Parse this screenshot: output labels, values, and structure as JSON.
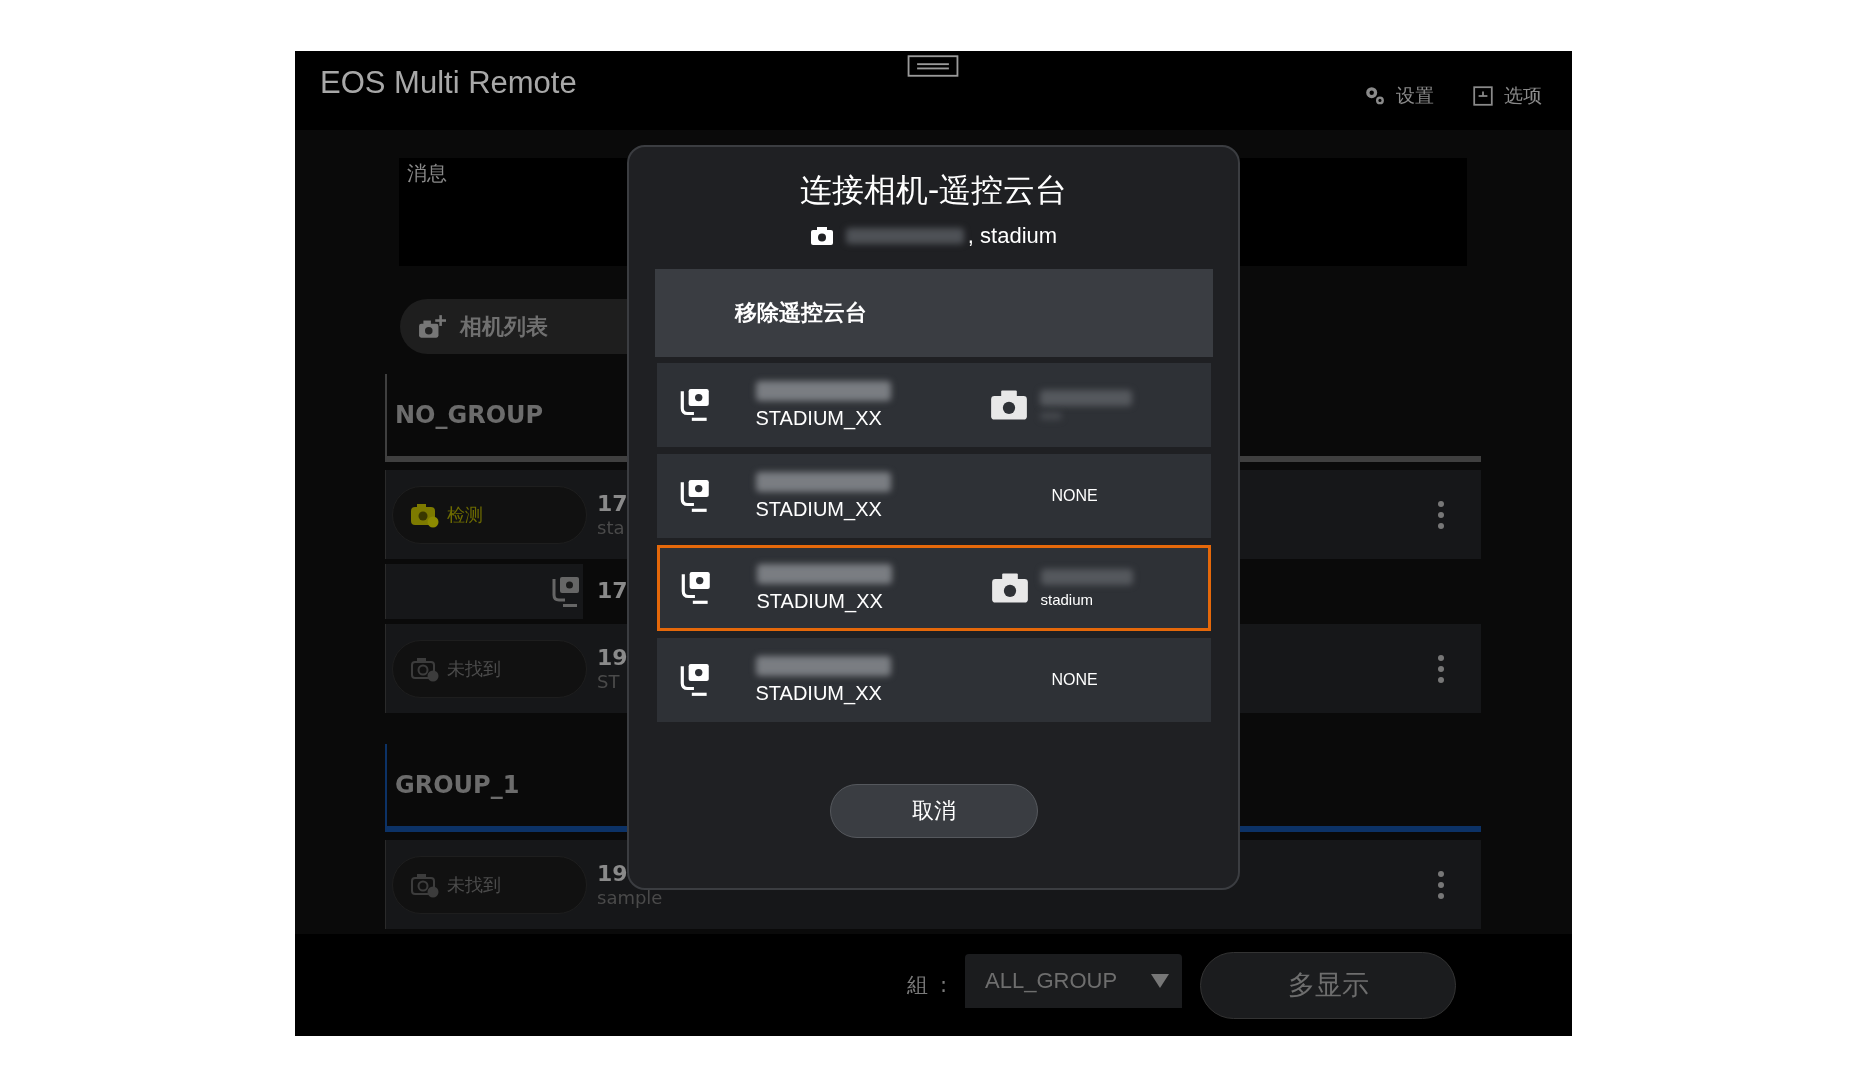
{
  "app": {
    "title": "EOS Multi Remote",
    "menu": [
      {
        "label": "设置",
        "kind": "settings"
      },
      {
        "label": "选项",
        "kind": "options"
      }
    ]
  },
  "message_panel": {
    "label": "消息"
  },
  "camera_list_button": {
    "label": "相机列表"
  },
  "groups": [
    {
      "name": "NO_GROUP",
      "color": "#3f3f3f",
      "rows": [
        {
          "kind": "camera",
          "status": {
            "kind": "detecting",
            "label": "检测"
          },
          "line_1": "17",
          "line_2": "sta"
        },
        {
          "kind": "ptz",
          "line_1": "17"
        },
        {
          "kind": "camera",
          "status": {
            "kind": "not_found",
            "label": "未找到"
          },
          "line_1": "19",
          "line_2": "ST"
        }
      ]
    },
    {
      "name": "GROUP_1",
      "color": "#0c3266",
      "rows": [
        {
          "kind": "camera",
          "status": {
            "kind": "not_found",
            "label": "未找到"
          },
          "line_1": "19",
          "line_2": "sample"
        }
      ]
    }
  ],
  "footer": {
    "group_label": "組",
    "separator": ":",
    "group_value": "ALL_GROUP",
    "multi_view_button": "多显示"
  },
  "dialog": {
    "title": "连接相机-遥控云台",
    "subtitle": ", stadium",
    "action": "移除遥控云台",
    "rows": [
      {
        "model": "STADIUM_XX",
        "linked": true,
        "selected": false
      },
      {
        "model": "STADIUM_XX",
        "linked": false,
        "status": "NONE",
        "selected": false
      },
      {
        "model": "STADIUM_XX",
        "linked": true,
        "camera_name": "stadium",
        "selected": true
      },
      {
        "model": "STADIUM_XX",
        "linked": false,
        "status": "NONE",
        "selected": false
      }
    ],
    "cancel_button": "取消"
  }
}
